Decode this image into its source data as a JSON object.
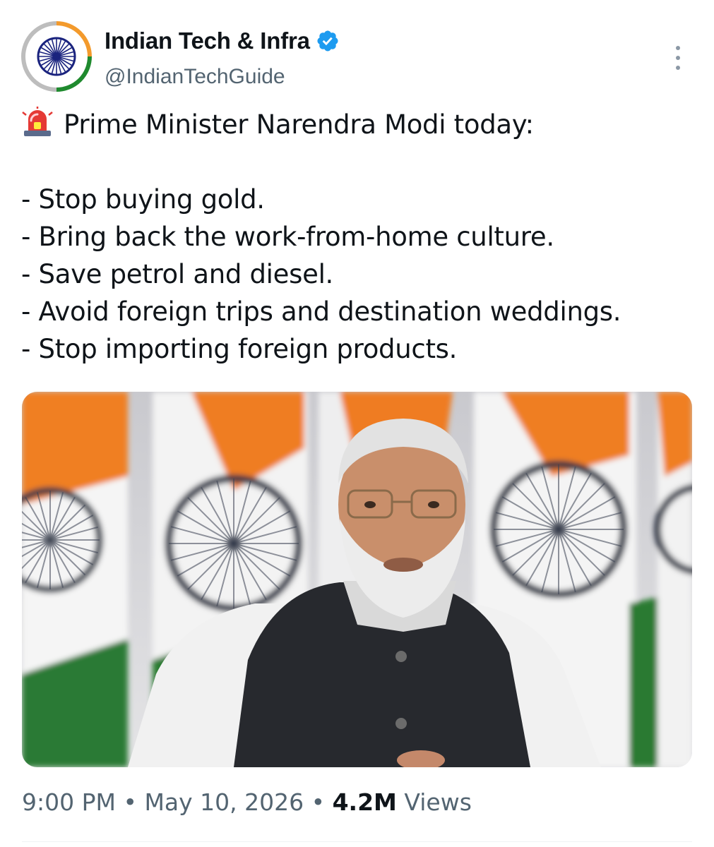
{
  "account": {
    "display_name": "Indian Tech & Infra",
    "handle": "@IndianTechGuide",
    "verified_icon": "verified-badge-icon",
    "avatar_icon": "ashoka-chakra-avatar"
  },
  "tweet": {
    "headline": "Prime Minister Narendra Modi today:",
    "headline_icon": "police-siren-emoji",
    "lines": [
      "- Stop buying gold.",
      "- Bring back the work-from-home culture.",
      "- Save petrol and diesel.",
      "- Avoid foreign trips and destination weddings.",
      "- Stop importing foreign products."
    ]
  },
  "meta": {
    "time": "9:00 PM",
    "separator": "•",
    "date": "May 10, 2026",
    "views_count": "4.2M",
    "views_label": "Views"
  },
  "colors": {
    "text": "#0f1419",
    "muted": "#536471",
    "verified": "#1d9bf0",
    "saffron": "#ff9933",
    "green": "#138808",
    "chakra_blue": "#000080"
  }
}
